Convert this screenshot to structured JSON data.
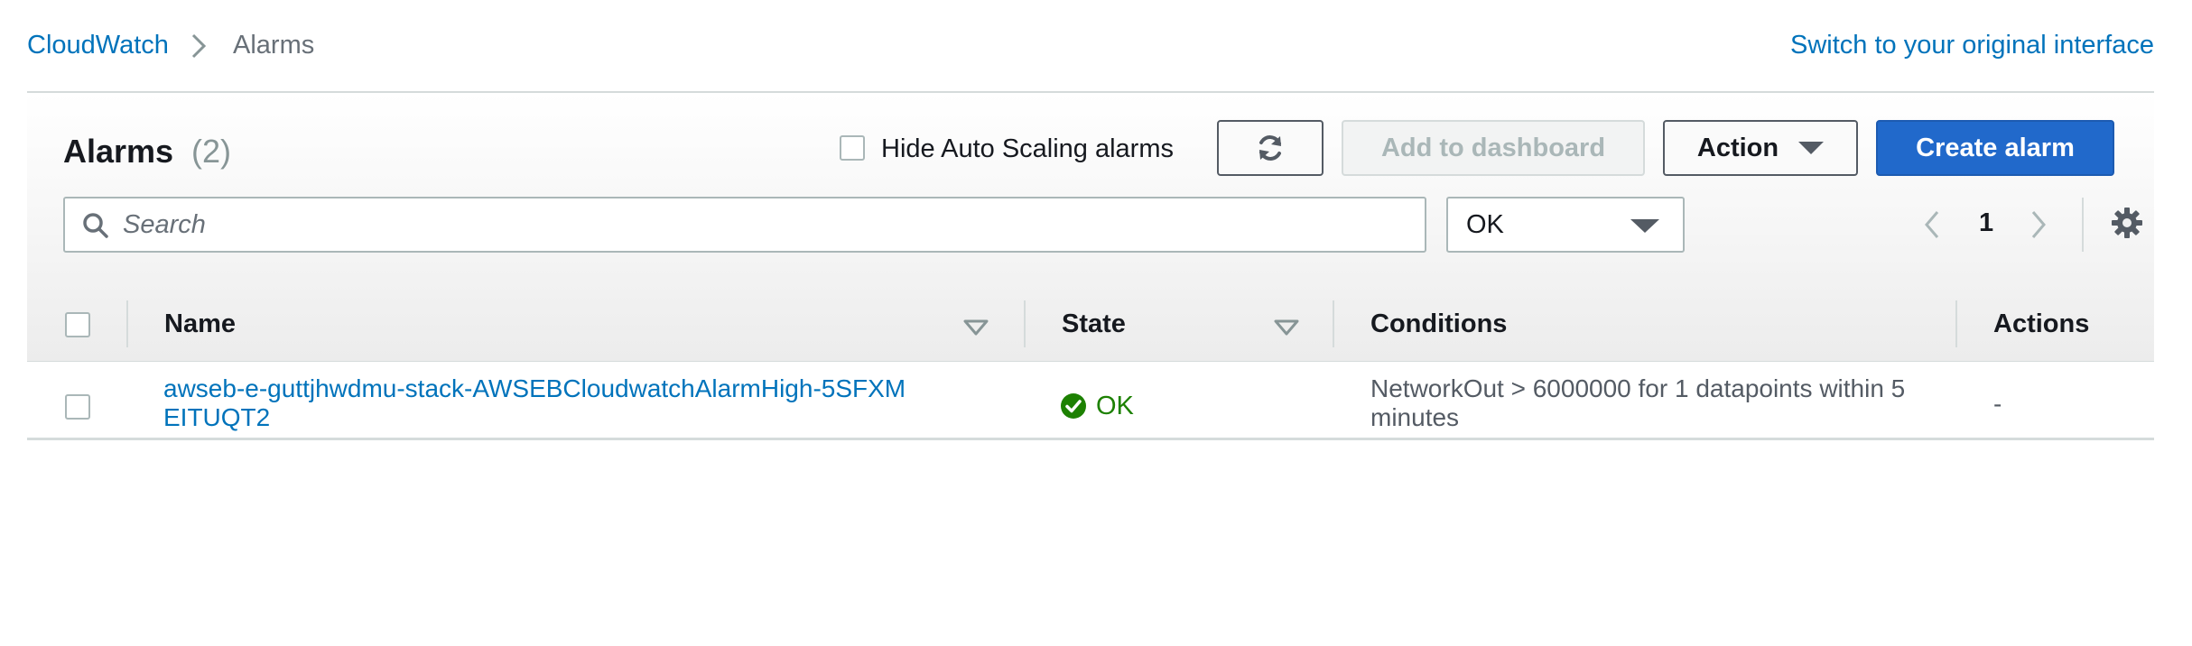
{
  "breadcrumb": {
    "root": "CloudWatch",
    "current": "Alarms"
  },
  "switch_link": "Switch to your original interface",
  "panel": {
    "title": "Alarms",
    "count": "(2)",
    "hide_autoscaling_label": "Hide Auto Scaling alarms",
    "hide_autoscaling_checked": false,
    "add_dashboard_label": "Add to dashboard",
    "action_label": "Action",
    "create_label": "Create alarm"
  },
  "search": {
    "placeholder": "Search",
    "value": ""
  },
  "state_filter": {
    "selected": "OK"
  },
  "pagination": {
    "current_page": "1"
  },
  "table": {
    "columns": [
      "Name",
      "State",
      "Conditions",
      "Actions"
    ],
    "rows": [
      {
        "name": "awseb-e-guttjhwdmu-stack-AWSEBCloudwatchAlarmHigh-5SFXMEITUQT2",
        "state": "OK",
        "conditions": "NetworkOut > 6000000 for 1 datapoints within 5 minutes",
        "actions": "-"
      }
    ]
  },
  "colors": {
    "link": "#0073bb",
    "primary_button": "#2169cb",
    "ok_green": "#1d8102"
  },
  "icons": [
    "chevron-right-icon",
    "refresh-icon",
    "caret-down-icon",
    "search-icon",
    "chevron-left-icon",
    "gear-icon",
    "sort-down-icon",
    "status-ok-icon"
  ]
}
